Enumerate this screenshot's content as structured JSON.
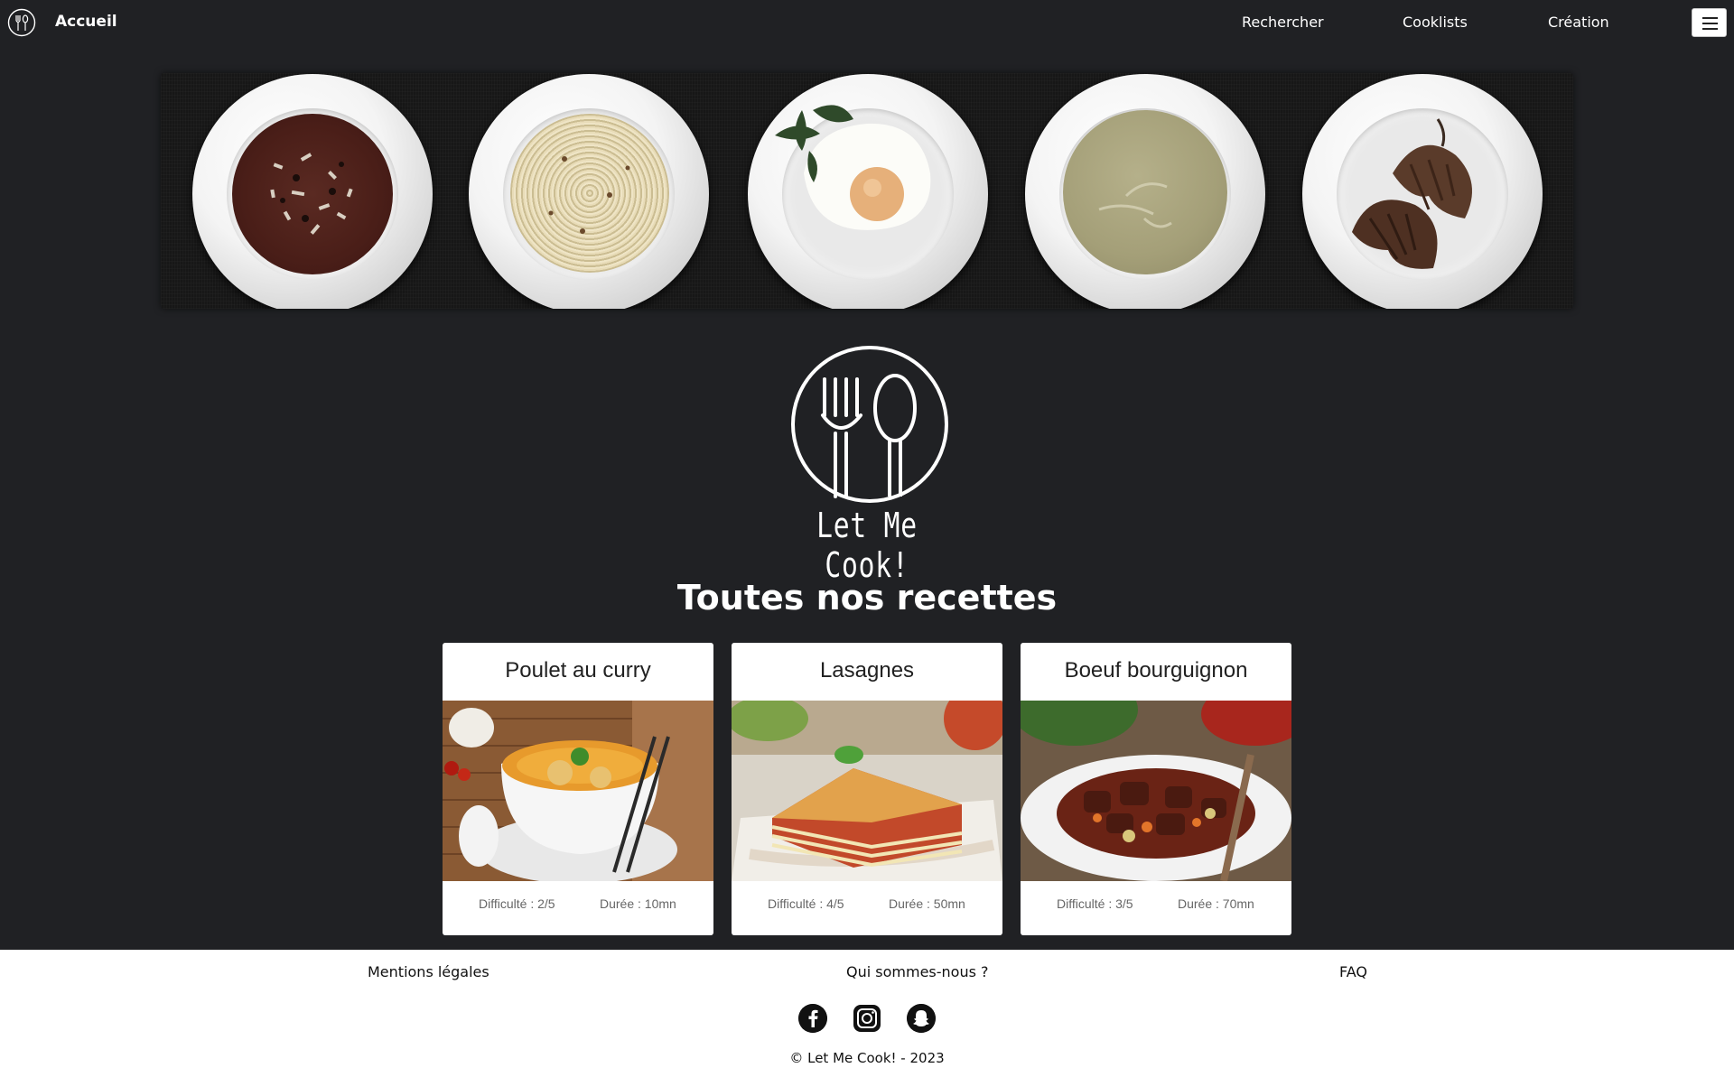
{
  "nav": {
    "home_label": "Accueil",
    "links": [
      "Rechercher",
      "Cooklists",
      "Création"
    ],
    "logo_icon": "fork-spoon-logo-icon",
    "menu_icon": "hamburger-menu-icon"
  },
  "hero": {
    "plates": [
      "soup-plate",
      "spaghetti-plate",
      "fried-egg-plate",
      "cream-soup-plate",
      "croissant-plate"
    ]
  },
  "brand": {
    "name": "Let Me Cook!"
  },
  "recipes": {
    "title": "Toutes nos recettes",
    "cards": [
      {
        "title": "Poulet au curry",
        "difficulty": "Difficulté : 2/5",
        "duration": "Durée : 10mn"
      },
      {
        "title": "Lasagnes",
        "difficulty": "Difficulté : 4/5",
        "duration": "Durée : 50mn"
      },
      {
        "title": "Boeuf bourguignon",
        "difficulty": "Difficulté : 3/5",
        "duration": "Durée : 70mn"
      }
    ]
  },
  "footer": {
    "links": [
      "Mentions légales",
      "Qui sommes-nous ?",
      "FAQ"
    ],
    "social": [
      "facebook-icon",
      "instagram-icon",
      "snapchat-icon"
    ],
    "copyright": "© Let Me Cook! - 2023"
  },
  "colors": {
    "background": "#202124",
    "card": "#ffffff",
    "footer": "#ffffff"
  }
}
